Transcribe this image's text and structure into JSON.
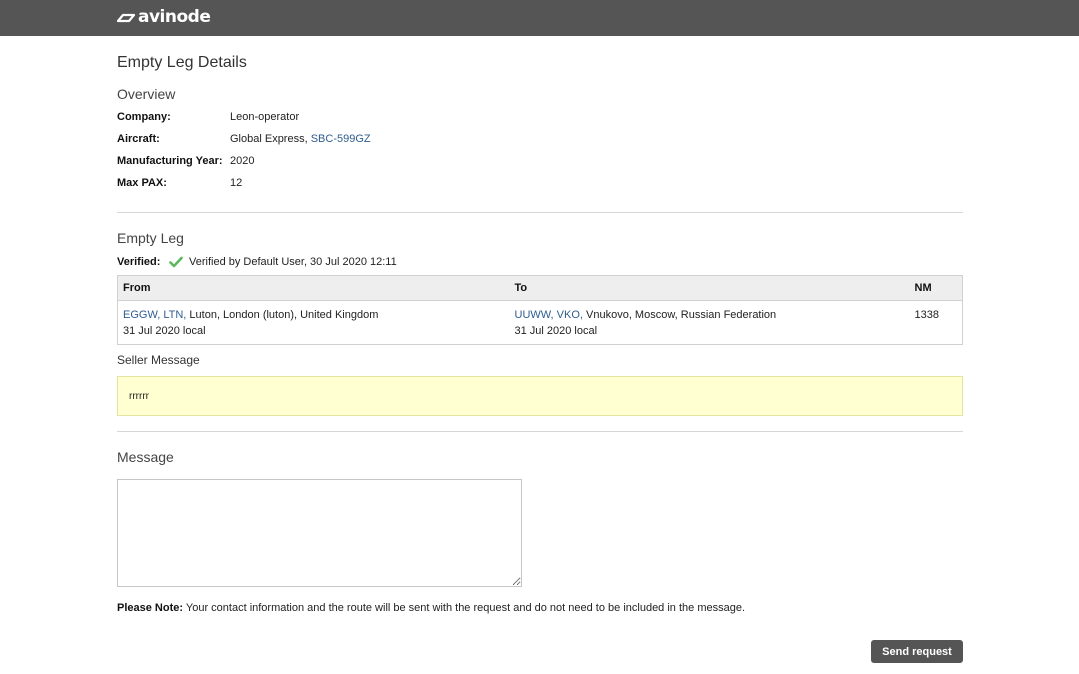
{
  "brand": {
    "name": "avinode"
  },
  "page": {
    "title": "Empty Leg Details"
  },
  "overview": {
    "title": "Overview",
    "company_label": "Company:",
    "company_value": "Leon-operator",
    "aircraft_label": "Aircraft:",
    "aircraft_type": "Global Express",
    "aircraft_separator": ",",
    "aircraft_reg": "SBC-599GZ",
    "year_label": "Manufacturing Year:",
    "year_value": "2020",
    "pax_label": "Max PAX:",
    "pax_value": "12"
  },
  "empty_leg": {
    "title": "Empty Leg",
    "verified_label": "Verified:",
    "verified_text": "Verified by Default User, 30 Jul 2020 12:11",
    "columns": {
      "from": "From",
      "to": "To",
      "nm": "NM"
    },
    "row": {
      "from_codes": "EGGW, LTN,",
      "from_place": "Luton, London (luton), United Kingdom",
      "from_date": "31 Jul 2020 local",
      "to_codes": "UUWW, VKO,",
      "to_place": "Vnukovo, Moscow, Russian Federation",
      "to_date": "31 Jul 2020 local",
      "nm": "1338"
    }
  },
  "seller": {
    "label": "Seller Message",
    "message": "rrrrrr"
  },
  "message": {
    "title": "Message",
    "value": "",
    "note_label": "Please Note:",
    "note_text": "Your contact information and the route will be sent with the request and do not need to be included in the message."
  },
  "actions": {
    "send_label": "Send request"
  },
  "colors": {
    "topbar": "#555555",
    "link": "#2f5d8f",
    "seller_bg": "#ffffd2",
    "check": "#5cb85c"
  }
}
